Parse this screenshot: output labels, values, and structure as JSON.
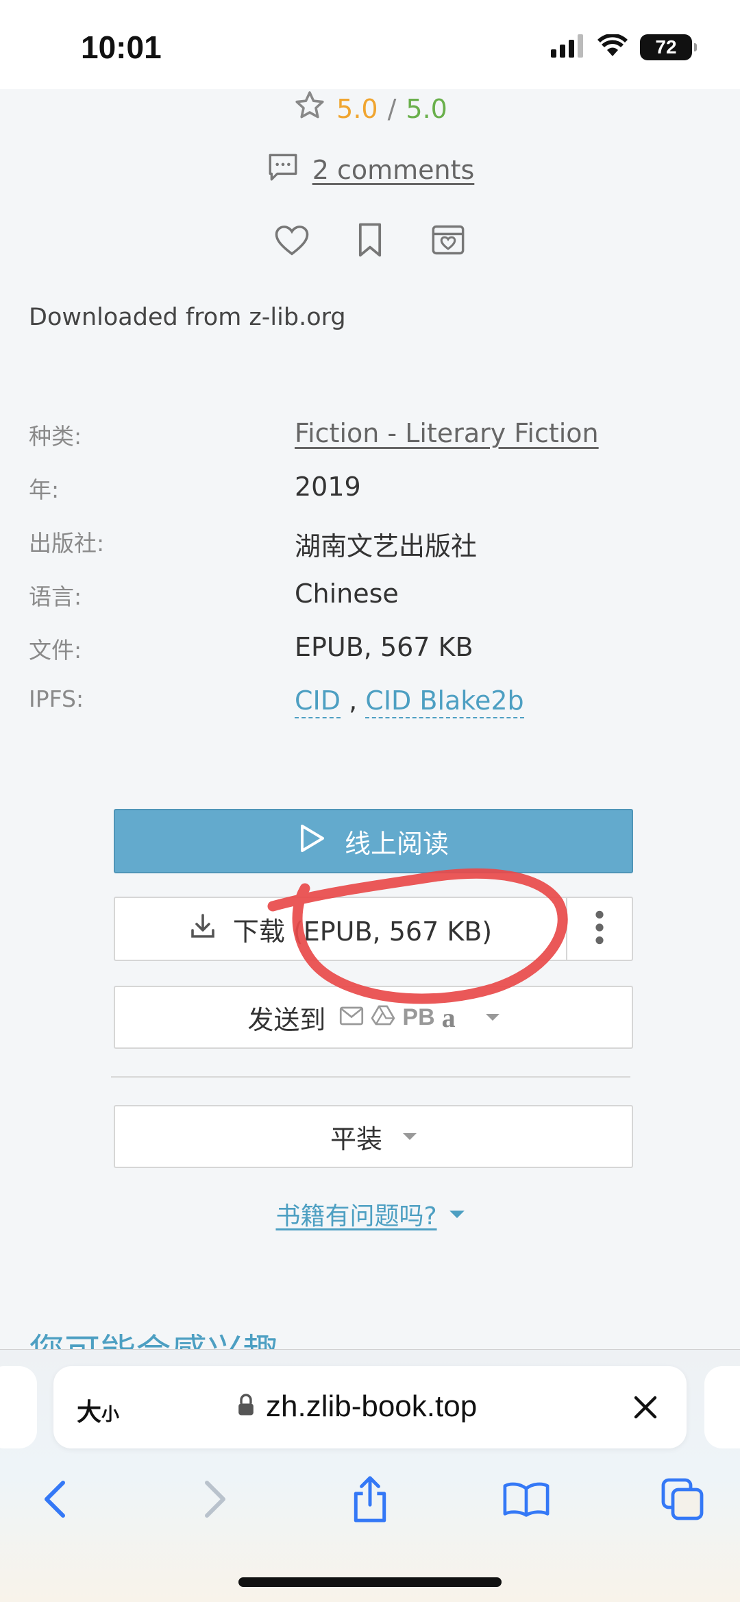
{
  "status": {
    "time": "10:01",
    "battery": "72"
  },
  "rating": {
    "score": "5.0",
    "separator": "/",
    "max": "5.0"
  },
  "comments": {
    "label": "2 comments"
  },
  "downloaded_note": "Downloaded from z-lib.org",
  "meta": {
    "category_label": "种类:",
    "category_value": "Fiction - Literary Fiction",
    "year_label": "年:",
    "year_value": "2019",
    "publisher_label": "出版社:",
    "publisher_value": "湖南文艺出版社",
    "language_label": "语言:",
    "language_value": "Chinese",
    "file_label": "文件:",
    "file_value": "EPUB, 567 KB",
    "ipfs_label": "IPFS:",
    "ipfs_cid": "CID",
    "ipfs_sep": ",",
    "ipfs_blake": "CID Blake2b"
  },
  "buttons": {
    "read_online": "线上阅读",
    "download": "下载 (EPUB, 567 KB)",
    "send_to": "发送到",
    "send_pb": "PB",
    "send_amazon": "a",
    "format": "平装"
  },
  "problem_link": "书籍有问题吗?",
  "section_interest": "您可能会感兴趣",
  "browser": {
    "text_size": "大",
    "text_size_small": "小",
    "url": "zh.zlib-book.top"
  },
  "colors": {
    "accent": "#63aacd",
    "link": "#4d9fc2",
    "rating_a": "#f0a530",
    "rating_b": "#6ab04c",
    "annotation": "#e84a4a"
  }
}
